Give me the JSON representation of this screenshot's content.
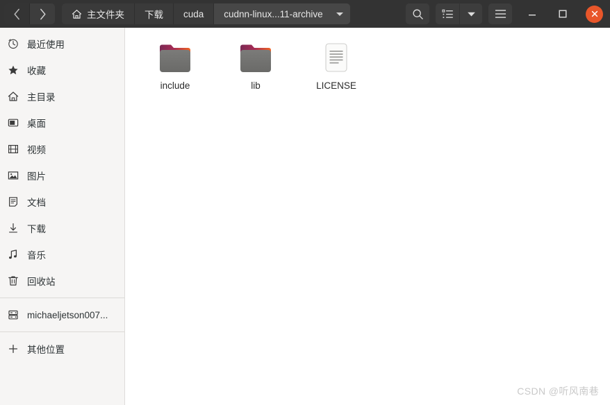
{
  "window": {
    "title": "cudnn-linux...11-archive"
  },
  "header": {
    "back_icon": "chevron-left-icon",
    "forward_icon": "chevron-right-icon",
    "breadcrumbs": [
      {
        "label": "主文件夹",
        "icon": "home-icon",
        "current": false
      },
      {
        "label": "下载",
        "icon": "",
        "current": false
      },
      {
        "label": "cuda",
        "icon": "",
        "current": false
      },
      {
        "label": "cudnn-linux...11-archive",
        "icon": "",
        "current": true
      }
    ],
    "actions": [
      {
        "name": "search-button",
        "icon": "search-icon"
      },
      {
        "name": "view-list-button",
        "icon": "list-view-icon"
      },
      {
        "name": "view-options-button",
        "icon": "chevron-down-icon"
      },
      {
        "name": "main-menu-button",
        "icon": "hamburger-menu-icon"
      }
    ],
    "window_controls": [
      {
        "name": "minimize-button",
        "icon": "minimize-icon",
        "glyph": "—"
      },
      {
        "name": "maximize-button",
        "icon": "maximize-icon",
        "glyph": "□"
      },
      {
        "name": "close-button",
        "icon": "close-icon",
        "glyph": "✕"
      }
    ],
    "close_color": "#e8562a",
    "bar_color": "#333333"
  },
  "sidebar": {
    "items": [
      {
        "label": "最近使用",
        "icon": "clock-icon"
      },
      {
        "label": "收藏",
        "icon": "star-icon"
      },
      {
        "label": "主目录",
        "icon": "home-icon"
      },
      {
        "label": "桌面",
        "icon": "desktop-icon"
      },
      {
        "label": "视频",
        "icon": "film-icon"
      },
      {
        "label": "图片",
        "icon": "image-icon"
      },
      {
        "label": "文档",
        "icon": "document-icon"
      },
      {
        "label": "下载",
        "icon": "download-icon"
      },
      {
        "label": "音乐",
        "icon": "music-note-icon"
      },
      {
        "label": "回收站",
        "icon": "trash-icon"
      }
    ],
    "devices": [
      {
        "label": "michaeljetson007...",
        "icon": "drive-icon"
      }
    ],
    "other": [
      {
        "label": "其他位置",
        "icon": "plus-icon"
      }
    ]
  },
  "files": [
    {
      "name": "include",
      "type": "folder",
      "icon": "folder-icon"
    },
    {
      "name": "lib",
      "type": "folder",
      "icon": "folder-icon"
    },
    {
      "name": "LICENSE",
      "type": "file",
      "icon": "text-file-icon"
    }
  ],
  "watermark": {
    "text": "CSDN @听风南巷"
  }
}
